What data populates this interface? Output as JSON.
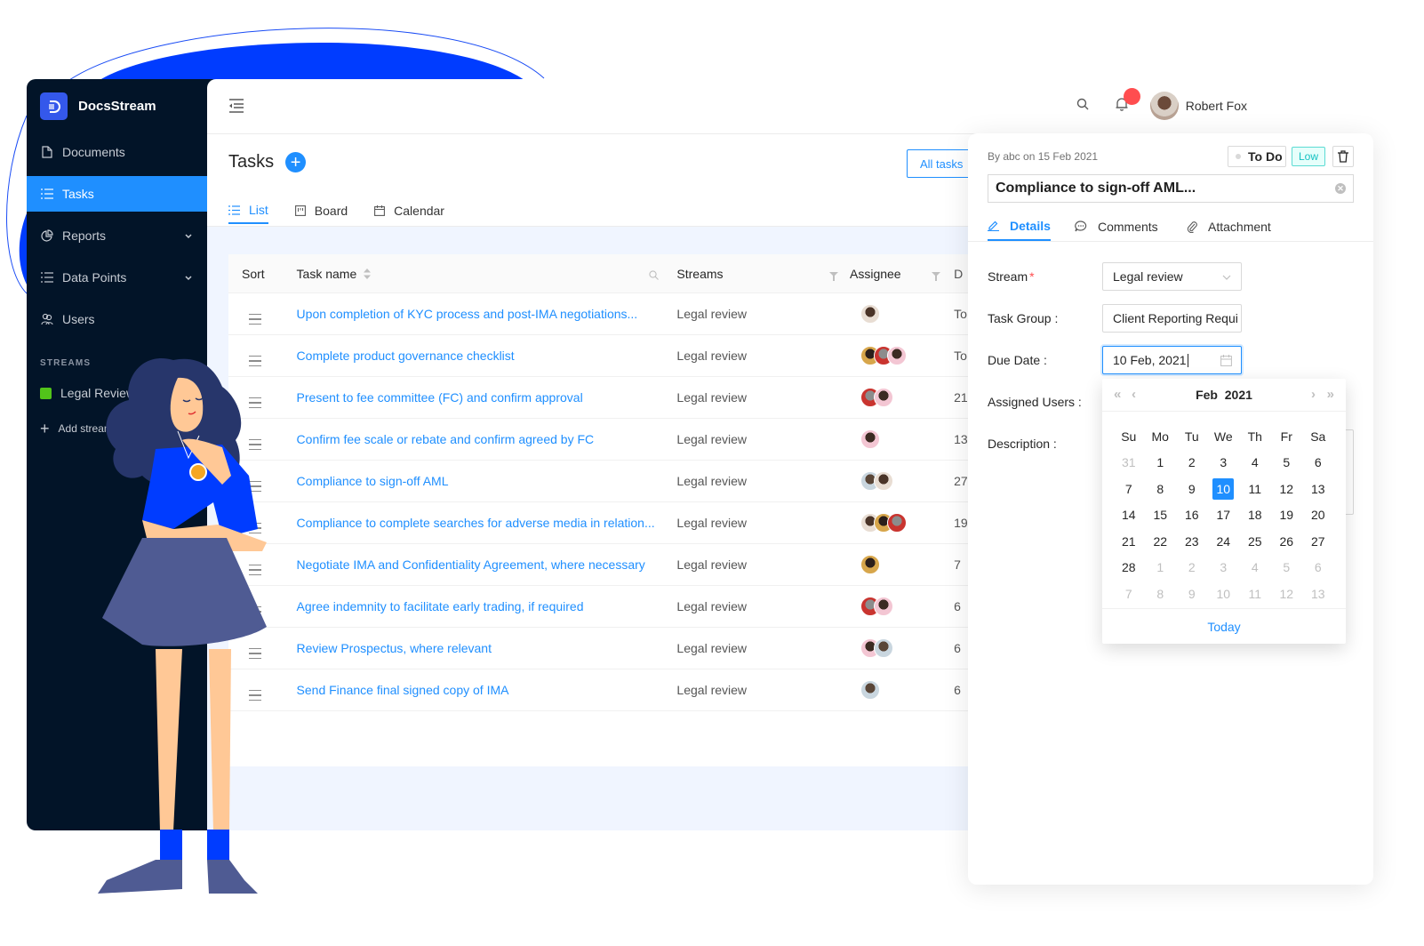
{
  "app": {
    "name": "DocsStream"
  },
  "sidebar": {
    "items": [
      {
        "label": "Documents",
        "icon": "document-icon",
        "active": false
      },
      {
        "label": "Tasks",
        "icon": "list-icon",
        "active": true
      },
      {
        "label": "Reports",
        "icon": "pie-chart-icon",
        "active": false,
        "expandable": true
      },
      {
        "label": "Data Points",
        "icon": "list-icon",
        "active": false,
        "expandable": true
      },
      {
        "label": "Users",
        "icon": "users-icon",
        "active": false
      }
    ],
    "streams_title": "STREAMS",
    "streams": [
      {
        "label": "Legal Review",
        "color": "#52c41a"
      }
    ],
    "add_stream": "Add stream"
  },
  "header": {
    "user_name": "Robert Fox",
    "notification_color": "#ff4d4f"
  },
  "page": {
    "title": "Tasks",
    "filter_button": "All tasks",
    "views": [
      {
        "label": "List",
        "active": true
      },
      {
        "label": "Board",
        "active": false
      },
      {
        "label": "Calendar",
        "active": false
      }
    ]
  },
  "table": {
    "columns": {
      "sort": "Sort",
      "name": "Task name",
      "stream": "Streams",
      "assignee": "Assignee",
      "due": "D"
    },
    "rows": [
      {
        "name": "Upon completion of KYC process and post-IMA negotiations...",
        "stream": "Legal review",
        "avatars": 1,
        "due": "To"
      },
      {
        "name": "Complete product governance checklist",
        "stream": "Legal review",
        "avatars": 3,
        "due": "To"
      },
      {
        "name": "Present to fee committee (FC) and confirm approval",
        "stream": "Legal review",
        "avatars": 2,
        "due": "21"
      },
      {
        "name": "Confirm fee scale or rebate and confirm agreed by FC",
        "stream": "Legal review",
        "avatars": 1,
        "due": "13"
      },
      {
        "name": "Compliance to sign-off AML",
        "stream": "Legal review",
        "avatars": 2,
        "due": "27"
      },
      {
        "name": "Compliance to complete searches for adverse media in relation...",
        "stream": "Legal review",
        "avatars": 3,
        "due": "19"
      },
      {
        "name": "Negotiate IMA and Confidentiality Agreement, where necessary",
        "stream": "Legal review",
        "avatars": 1,
        "due": "7"
      },
      {
        "name": "Agree indemnity to facilitate early trading, if required",
        "stream": "Legal review",
        "avatars": 2,
        "due": "6"
      },
      {
        "name": "Review Prospectus, where relevant",
        "stream": "Legal review",
        "avatars": 2,
        "due": "6"
      },
      {
        "name": "Send Finance final signed copy of IMA",
        "stream": "Legal review",
        "avatars": 1,
        "due": "6"
      }
    ]
  },
  "detail": {
    "meta": "By abc on 15 Feb 2021",
    "status": "To Do",
    "priority": "Low",
    "title": "Compliance to sign-off AML...",
    "tabs": [
      {
        "label": "Details",
        "active": true
      },
      {
        "label": "Comments",
        "active": false
      },
      {
        "label": "Attachment",
        "active": false
      }
    ],
    "fields": {
      "stream_label": "Stream",
      "stream_value": "Legal review",
      "task_group_label": "Task Group :",
      "task_group_value": "Client Reporting Requi",
      "due_date_label": "Due Date :",
      "due_date_value": "10 Feb, 2021",
      "assigned_users_label": "Assigned Users :",
      "description_label": "Description :"
    }
  },
  "calendar": {
    "month": "Feb",
    "year": "2021",
    "weekdays": [
      "Su",
      "Mo",
      "Tu",
      "We",
      "Th",
      "Fr",
      "Sa"
    ],
    "weeks": [
      [
        "31",
        "1",
        "2",
        "3",
        "4",
        "5",
        "6"
      ],
      [
        "7",
        "8",
        "9",
        "10",
        "11",
        "12",
        "13"
      ],
      [
        "14",
        "15",
        "16",
        "17",
        "18",
        "19",
        "20"
      ],
      [
        "21",
        "22",
        "23",
        "24",
        "25",
        "26",
        "27"
      ],
      [
        "28",
        "1",
        "2",
        "3",
        "4",
        "5",
        "6"
      ],
      [
        "7",
        "8",
        "9",
        "10",
        "11",
        "12",
        "13"
      ]
    ],
    "selected_day": "10",
    "today_label": "Today"
  }
}
